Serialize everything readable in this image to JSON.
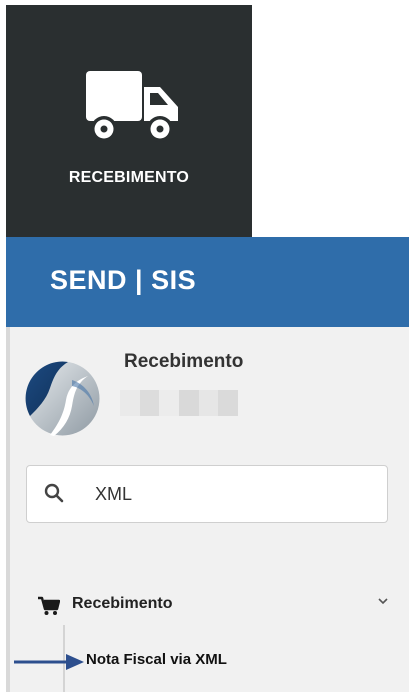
{
  "tile": {
    "label": "RECEBIMENTO",
    "icon": "truck-icon"
  },
  "header": {
    "brand": "SEND | SIS",
    "color": "#2f6daa"
  },
  "sidebar": {
    "profile": {
      "name": "Recebimento",
      "logo": "company-logo"
    },
    "search": {
      "value": "XML",
      "icon": "search-icon"
    },
    "menu": [
      {
        "label": "Recebimento",
        "icon": "cart-icon",
        "expanded": true,
        "children": [
          {
            "label": "Nota Fiscal via XML"
          }
        ]
      }
    ]
  },
  "annotation": {
    "arrow_color": "#2d4f8e"
  }
}
